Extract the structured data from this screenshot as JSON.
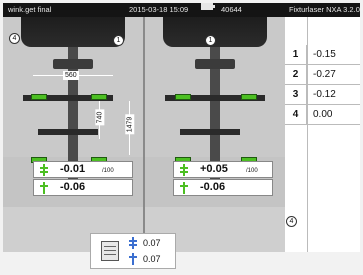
{
  "status": {
    "filename": "wink.get final",
    "datetime": "2015-03-18  15:09",
    "counter": "40644",
    "product": "Fixturlaser NXA  3.2.0",
    "badge": "4"
  },
  "dimensions": {
    "width": "560",
    "h1": "740",
    "h2": "1479"
  },
  "markers": {
    "left_top": "1",
    "right_top": "1",
    "table_bottom": "4"
  },
  "readouts": {
    "left": [
      {
        "value": "-0.01",
        "unit": "/100"
      },
      {
        "value": "-0.06",
        "unit": ""
      }
    ],
    "right": [
      {
        "value": "+0.05",
        "unit": "/100"
      },
      {
        "value": "-0.06",
        "unit": ""
      }
    ]
  },
  "table": [
    {
      "n": "1",
      "v": "-0.15"
    },
    {
      "n": "2",
      "v": "-0.27"
    },
    {
      "n": "3",
      "v": "-0.12"
    },
    {
      "n": "4",
      "v": "0.00"
    }
  ],
  "summary": {
    "v1": "0.07",
    "v2": "0.07"
  },
  "colors": {
    "sensor": "#4cbf22",
    "status_bar": "#141414",
    "background": "#c9c9c9"
  }
}
